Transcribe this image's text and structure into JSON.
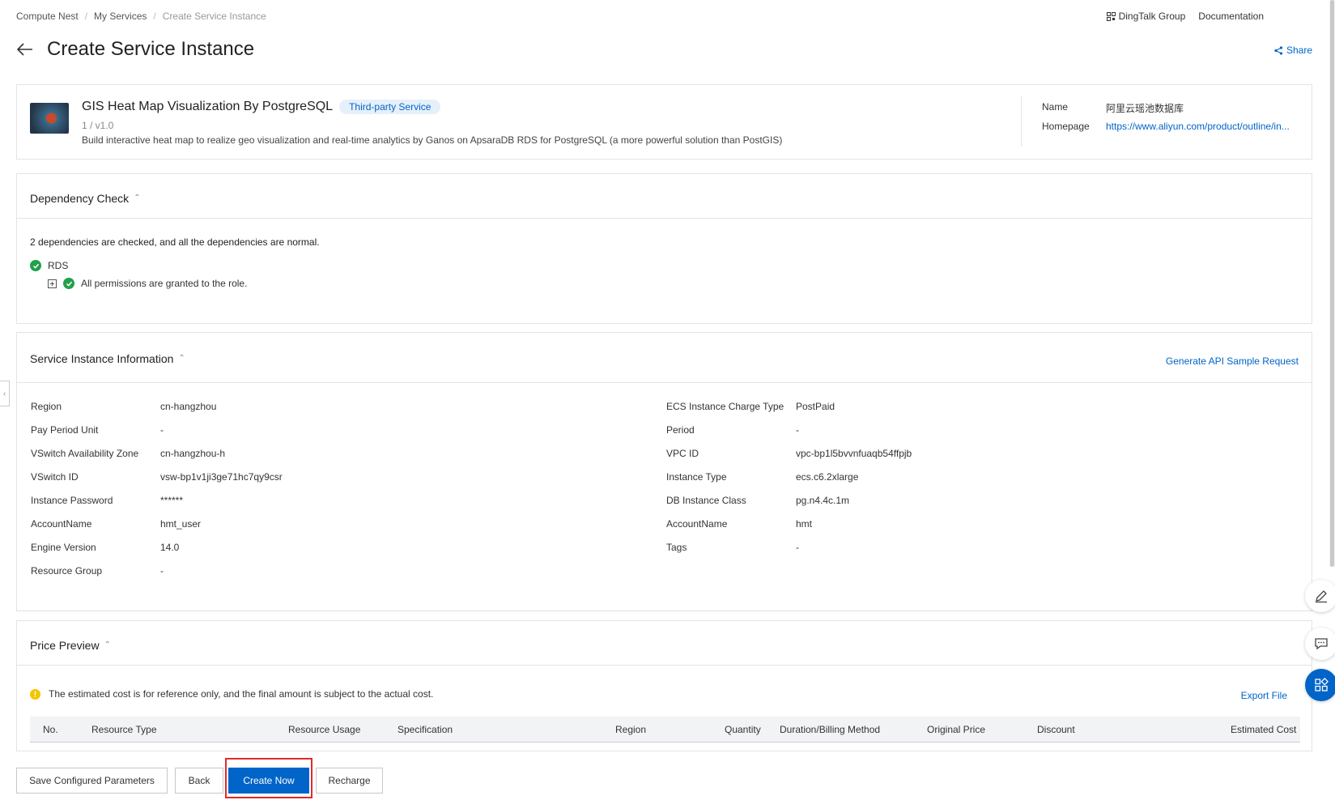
{
  "breadcrumb": {
    "items": [
      "Compute Nest",
      "My Services",
      "Create Service Instance"
    ],
    "separator": "/"
  },
  "top_links": {
    "dingtalk": "DingTalk Group",
    "docs": "Documentation"
  },
  "header": {
    "title": "Create Service Instance",
    "share": "Share"
  },
  "service": {
    "name": "GIS Heat Map Visualization By PostgreSQL",
    "badge": "Third-party Service",
    "version": "1 / v1.0",
    "description": "Build interactive heat map to realize geo visualization and real-time analytics by Ganos on ApsaraDB RDS for PostgreSQL (a more powerful solution than PostGIS)",
    "name_label": "Name",
    "name_value": "阿里云瑶池数据库",
    "homepage_label": "Homepage",
    "homepage_value": "https://www.aliyun.com/product/outline/in..."
  },
  "dependency": {
    "title": "Dependency Check",
    "summary": "2 dependencies are checked, and all the dependencies are normal.",
    "item": "RDS",
    "sub_item": "All permissions are granted to the role."
  },
  "info": {
    "title": "Service Instance Information",
    "api_link": "Generate API Sample Request",
    "left": [
      {
        "label": "Region",
        "value": "cn-hangzhou"
      },
      {
        "label": "Pay Period Unit",
        "value": "-"
      },
      {
        "label": "VSwitch Availability Zone",
        "value": "cn-hangzhou-h"
      },
      {
        "label": "VSwitch ID",
        "value": "vsw-bp1v1ji3ge71hc7qy9csr"
      },
      {
        "label": "Instance Password",
        "value": "******"
      },
      {
        "label": "AccountName",
        "value": "hmt_user"
      },
      {
        "label": "Engine Version",
        "value": "14.0"
      },
      {
        "label": "Resource Group",
        "value": "-"
      }
    ],
    "right": [
      {
        "label": "ECS Instance Charge Type",
        "value": "PostPaid"
      },
      {
        "label": "Period",
        "value": "-"
      },
      {
        "label": "VPC ID",
        "value": "vpc-bp1l5bvvnfuaqb54ffpjb"
      },
      {
        "label": "Instance Type",
        "value": "ecs.c6.2xlarge"
      },
      {
        "label": "DB Instance Class",
        "value": "pg.n4.4c.1m"
      },
      {
        "label": "AccountName",
        "value": "hmt"
      },
      {
        "label": "Tags",
        "value": "-"
      }
    ]
  },
  "price": {
    "title": "Price Preview",
    "notice": "The estimated cost is for reference only, and the final amount is subject to the actual cost.",
    "export": "Export File",
    "columns": [
      "No.",
      "Resource Type",
      "Resource Usage",
      "Specification",
      "Region",
      "Quantity",
      "Duration/Billing Method",
      "Original Price",
      "Discount",
      "Estimated Cost"
    ]
  },
  "footer": {
    "save": "Save Configured Parameters",
    "back": "Back",
    "create": "Create Now",
    "recharge": "Recharge"
  },
  "colors": {
    "primary": "#0064c8",
    "success": "#22a04a",
    "warning": "#f5c400",
    "highlight": "#e02a2a"
  }
}
